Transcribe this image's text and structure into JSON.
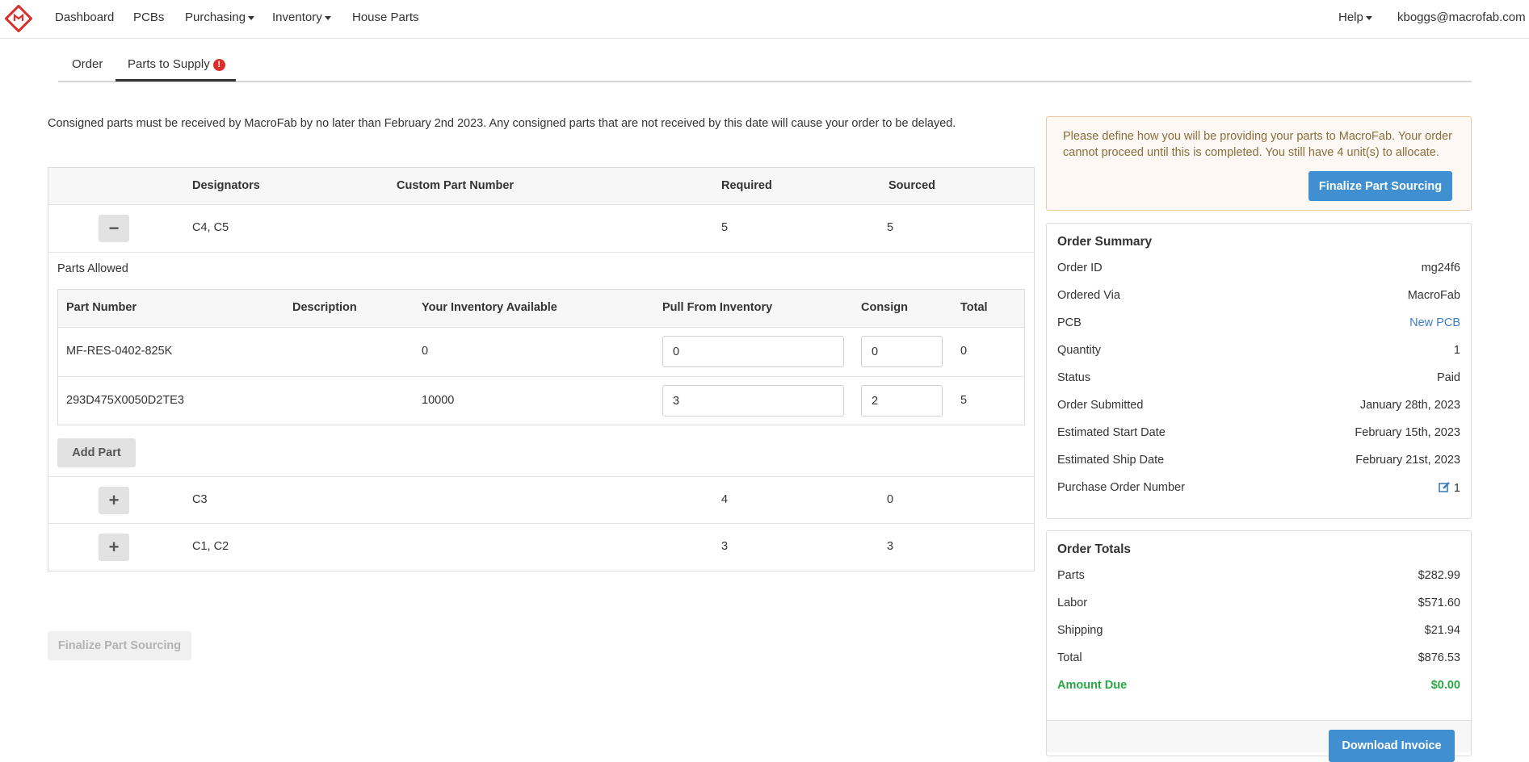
{
  "nav": {
    "items": [
      "Dashboard",
      "PCBs",
      "Purchasing",
      "Inventory",
      "House Parts"
    ],
    "help": "Help",
    "user": "kboggs@macrofab.com"
  },
  "tabs": {
    "order": "Order",
    "parts_to_supply": "Parts to Supply",
    "alert": "!"
  },
  "notice": "Consigned parts must be received by MacroFab by no later than February 2nd 2023.  Any consigned parts that are not received by this date will cause your order to be delayed.",
  "main_table": {
    "headers": {
      "designators": "Designators",
      "custom_part_number": "Custom Part Number",
      "required": "Required",
      "sourced": "Sourced"
    },
    "rows": [
      {
        "toggle": "−",
        "designators": "C4, C5",
        "required": "5",
        "sourced": "5"
      },
      {
        "toggle": "+",
        "designators": "C3",
        "required": "4",
        "sourced": "0"
      },
      {
        "toggle": "+",
        "designators": "C1, C2",
        "required": "3",
        "sourced": "3"
      }
    ],
    "parts_allowed_label": "Parts Allowed",
    "sub_headers": {
      "part_number": "Part Number",
      "description": "Description",
      "inventory": "Your Inventory Available",
      "pull": "Pull From Inventory",
      "consign": "Consign",
      "total": "Total"
    },
    "sub_rows": [
      {
        "part_number": "MF-RES-0402-825K",
        "description": "",
        "inventory": "0",
        "pull": "0",
        "consign": "0",
        "total": "0"
      },
      {
        "part_number": "293D475X0050D2TE3",
        "description": "",
        "inventory": "10000",
        "pull": "3",
        "consign": "2",
        "total": "5"
      }
    ],
    "add_part": "Add Part"
  },
  "finalize_disabled": "Finalize Part Sourcing",
  "warning": {
    "text": "Please define how you will be providing your parts to MacroFab. Your order cannot proceed until this is completed. You still have 4 unit(s) to allocate.",
    "button": "Finalize Part Sourcing"
  },
  "order_summary": {
    "title": "Order Summary",
    "rows": [
      {
        "label": "Order ID",
        "value": "mg24f6"
      },
      {
        "label": "Ordered Via",
        "value": "MacroFab"
      },
      {
        "label": "PCB",
        "value": "New PCB"
      },
      {
        "label": "Quantity",
        "value": "1"
      },
      {
        "label": "Status",
        "value": "Paid"
      },
      {
        "label": "Order Submitted",
        "value": "January 28th, 2023"
      },
      {
        "label": "Estimated Start Date",
        "value": "February 15th, 2023"
      },
      {
        "label": "Estimated Ship Date",
        "value": "February 21st, 2023"
      },
      {
        "label": "Purchase Order Number",
        "value": "1"
      }
    ]
  },
  "order_totals": {
    "title": "Order Totals",
    "rows": [
      {
        "label": "Parts",
        "value": "$282.99"
      },
      {
        "label": "Labor",
        "value": "$571.60"
      },
      {
        "label": "Shipping",
        "value": "$21.94"
      },
      {
        "label": "Total",
        "value": "$876.53"
      },
      {
        "label": "Amount Due",
        "value": "$0.00"
      }
    ],
    "download": "Download Invoice"
  },
  "colors": {
    "primary": "#3f8fd1",
    "link": "#3d7fc2",
    "alert": "#d9302c",
    "amount_due": "#29a745",
    "warning_bg": "#fdf8f3",
    "warning_text": "#8a6d3b"
  }
}
